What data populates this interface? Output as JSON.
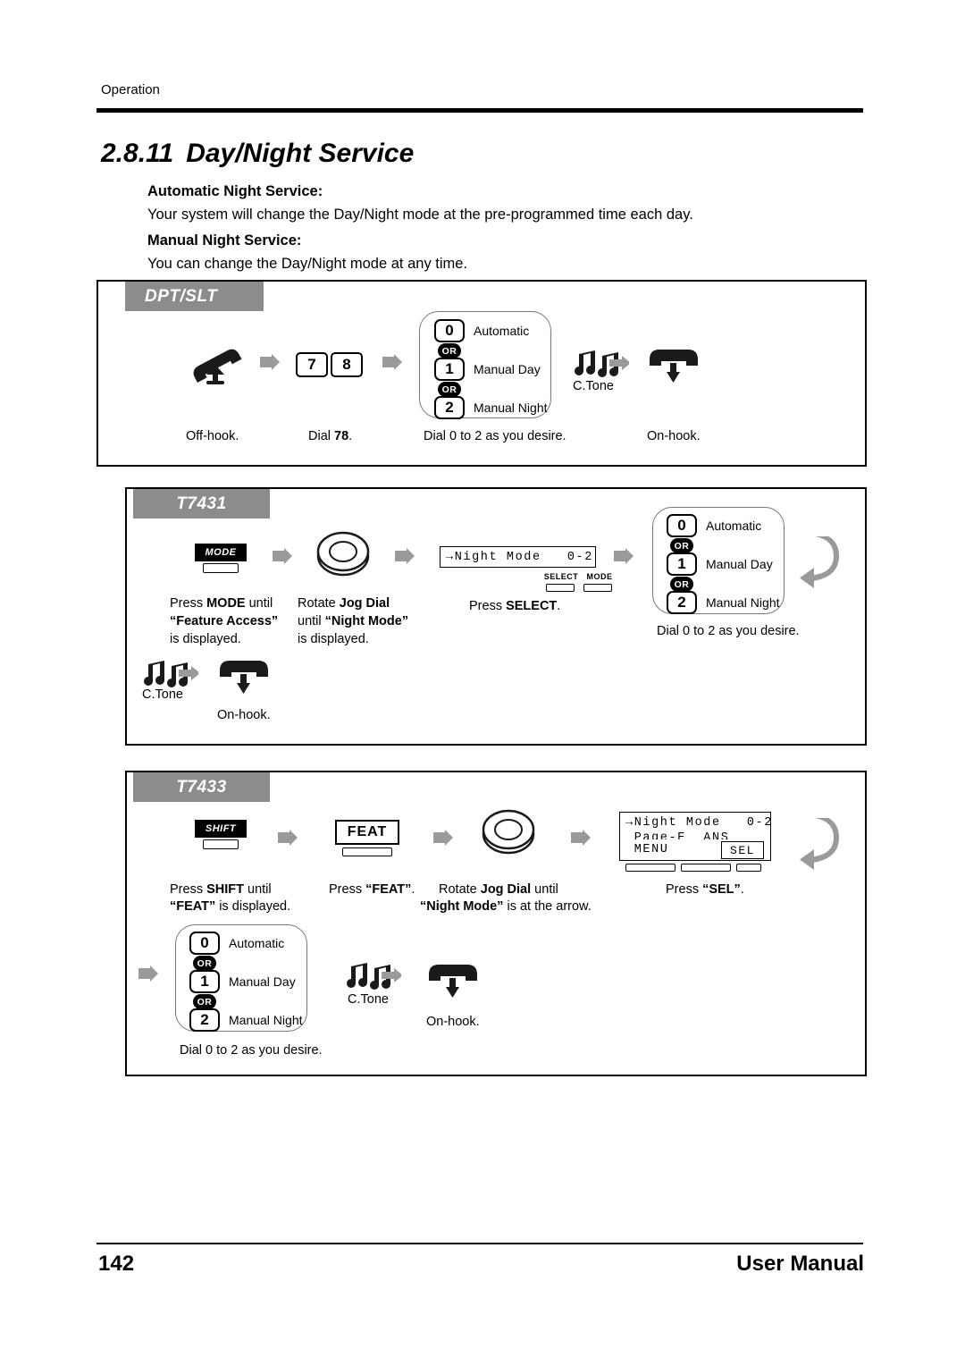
{
  "header": {
    "running_head": "Operation"
  },
  "title": {
    "number": "2.8.11",
    "text": "Day/Night Service"
  },
  "intro": {
    "heading1": "Automatic Night Service:",
    "para1": "Your system will change the Day/Night mode at the pre-programmed time each day.",
    "heading2": "Manual Night Service:",
    "para2": "You can change the Day/Night mode at any time."
  },
  "options": {
    "zero": "0",
    "one": "1",
    "two": "2",
    "or": "OR",
    "automatic": "Automatic",
    "manual_day": "Manual Day",
    "manual_night": "Manual Night"
  },
  "panel_dptslt": {
    "tab": "DPT/SLT",
    "step_offhook": "Off-hook.",
    "step_dial": "Dial 78.",
    "step_dial_prefix": "Dial ",
    "step_dial_number": "78",
    "step_dial_suffix": ".",
    "step_dial_options": "Dial 0 to 2 as you desire.",
    "ctone": "C.Tone",
    "step_onhook": "On-hook.",
    "digit7": "7",
    "digit8": "8"
  },
  "panel_t7431": {
    "tab": "T7431",
    "mode_button": "MODE",
    "step_mode_l1": "Press MODE until",
    "step_mode_l2": "“Feature Access”",
    "step_mode_l3": "is displayed.",
    "step_jog_l1": "Rotate Jog Dial",
    "step_jog_l2": "until “Night Mode”",
    "step_jog_l3": "is displayed.",
    "lcd_line1": "→Night Mode   0-2",
    "softkey_select": "SELECT",
    "softkey_mode": "MODE",
    "step_select": "Press SELECT.",
    "step_dial_options": "Dial 0 to 2 as you desire.",
    "ctone": "C.Tone",
    "step_onhook": "On-hook."
  },
  "panel_t7433": {
    "tab": "T7433",
    "shift_button": "SHIFT",
    "feat_button": "FEAT",
    "step_shift_l1": "Press SHIFT until",
    "step_shift_l2": "“FEAT” is displayed.",
    "step_feat": "Press “FEAT”.",
    "step_jog_l1": "Rotate Jog Dial until",
    "step_jog_l2": "“Night Mode” is at the arrow.",
    "lcd_line1": "→Night Mode   0-2",
    "lcd_line2": " Page-E  ANS",
    "lcd_line3": " MENU",
    "lcd_sel": "SEL",
    "step_sel": "Press “SEL”.",
    "step_dial_options": "Dial 0 to 2 as you desire.",
    "ctone": "C.Tone",
    "step_onhook": "On-hook."
  },
  "footer": {
    "page_number": "142",
    "manual": "User Manual"
  }
}
